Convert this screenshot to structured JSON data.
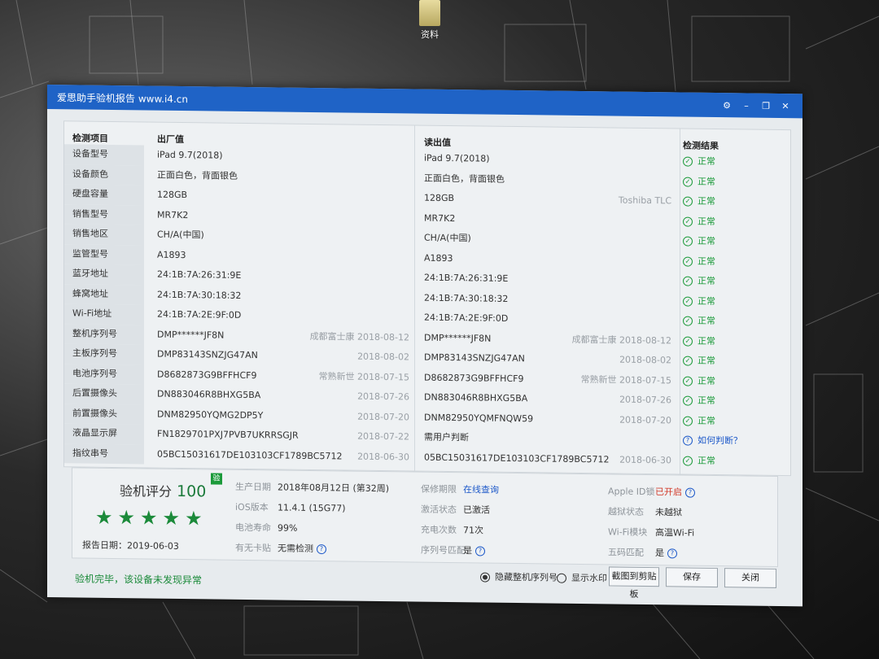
{
  "desktop": {
    "folder_label": "资料"
  },
  "window": {
    "title": "爱思助手验机报告 www.i4.cn"
  },
  "table": {
    "headers": {
      "item": "检测项目",
      "factory": "出厂值",
      "read": "读出值",
      "result": "检测结果"
    },
    "rows": [
      {
        "label": "设备型号",
        "factory": "iPad 9.7(2018)",
        "factory_extra": "",
        "read": "iPad 9.7(2018)",
        "read_extra": "",
        "result": "正常"
      },
      {
        "label": "设备颜色",
        "factory": "正面白色，背面银色",
        "factory_extra": "",
        "read": "正面白色，背面银色",
        "read_extra": "",
        "result": "正常"
      },
      {
        "label": "硬盘容量",
        "factory": "128GB",
        "factory_extra": "",
        "read": "128GB",
        "read_extra": "Toshiba TLC",
        "result": "正常"
      },
      {
        "label": "销售型号",
        "factory": "MR7K2",
        "factory_extra": "",
        "read": "MR7K2",
        "read_extra": "",
        "result": "正常"
      },
      {
        "label": "销售地区",
        "factory": "CH/A(中国)",
        "factory_extra": "",
        "read": "CH/A(中国)",
        "read_extra": "",
        "result": "正常"
      },
      {
        "label": "监管型号",
        "factory": "A1893",
        "factory_extra": "",
        "read": "A1893",
        "read_extra": "",
        "result": "正常"
      },
      {
        "label": "蓝牙地址",
        "factory": "24:1B:7A:26:31:9E",
        "factory_extra": "",
        "read": "24:1B:7A:26:31:9E",
        "read_extra": "",
        "result": "正常"
      },
      {
        "label": "蜂窝地址",
        "factory": "24:1B:7A:30:18:32",
        "factory_extra": "",
        "read": "24:1B:7A:30:18:32",
        "read_extra": "",
        "result": "正常"
      },
      {
        "label": "Wi-Fi地址",
        "factory": "24:1B:7A:2E:9F:0D",
        "factory_extra": "",
        "read": "24:1B:7A:2E:9F:0D",
        "read_extra": "",
        "result": "正常"
      },
      {
        "label": "整机序列号",
        "factory": "DMP******JF8N",
        "factory_extra": "成都富士康 2018-08-12",
        "read": "DMP******JF8N",
        "read_extra": "成都富士康 2018-08-12",
        "result": "正常"
      },
      {
        "label": "主板序列号",
        "factory": "DMP83143SNZJG47AN",
        "factory_extra": "2018-08-02",
        "read": "DMP83143SNZJG47AN",
        "read_extra": "2018-08-02",
        "result": "正常"
      },
      {
        "label": "电池序列号",
        "factory": "D8682873G9BFFHCF9",
        "factory_extra": "常熟新世 2018-07-15",
        "read": "D8682873G9BFFHCF9",
        "read_extra": "常熟新世 2018-07-15",
        "result": "正常"
      },
      {
        "label": "后置摄像头",
        "factory": "DN883046R8BHXG5BA",
        "factory_extra": "2018-07-26",
        "read": "DN883046R8BHXG5BA",
        "read_extra": "2018-07-26",
        "result": "正常"
      },
      {
        "label": "前置摄像头",
        "factory": "DNM82950YQMG2DP5Y",
        "factory_extra": "2018-07-20",
        "read": "DNM82950YQMFNQW59",
        "read_extra": "2018-07-20",
        "result": "正常"
      },
      {
        "label": "液晶显示屏",
        "factory": "FN1829701PXJ7PVB7UKRRSGJR",
        "factory_extra": "2018-07-22",
        "read": "需用户判断",
        "read_extra": "",
        "result": "如何判断？",
        "result_kind": "help"
      },
      {
        "label": "指纹串号",
        "factory": "05BC15031617DE103103CF1789BC5712",
        "factory_extra": "2018-06-30",
        "read": "05BC15031617DE103103CF1789BC5712",
        "read_extra": "2018-06-30",
        "result": "正常"
      }
    ]
  },
  "summary": {
    "score_label": "验机评分",
    "score": "100",
    "badge": "验",
    "stars": "★★★★★",
    "report_date": "报告日期：2019-06-03",
    "info": [
      {
        "key": "生产日期",
        "value": "2018年08月12日 (第32周)"
      },
      {
        "key": "iOS版本",
        "value": "11.4.1 (15G77)"
      },
      {
        "key": "电池寿命",
        "value": "99%"
      },
      {
        "key": "有无卡贴",
        "value": "无需检测"
      },
      {
        "key": "保修期限",
        "value": "在线查询"
      },
      {
        "key": "激活状态",
        "value": "已激活"
      },
      {
        "key": "充电次数",
        "value": "71次"
      },
      {
        "key": "序列号匹配",
        "value": "是"
      },
      {
        "key": "Apple ID锁",
        "value": "已开启"
      },
      {
        "key": "越狱状态",
        "value": "未越狱"
      },
      {
        "key": "Wi-Fi模块",
        "value": "高温Wi-Fi"
      },
      {
        "key": "五码匹配",
        "value": "是"
      }
    ]
  },
  "footer": {
    "status": "验机完毕，该设备未发现异常",
    "hide_serial": "隐藏整机序列号",
    "show_watermark": "显示水印",
    "screenshot_btn": "截图到剪贴板",
    "save_btn": "保存",
    "close_btn": "关闭"
  },
  "colors": {
    "titlebar": "#1f63c6",
    "ok_green": "#1b9a3a",
    "link_blue": "#1d59c9",
    "warn_red": "#d23a2a"
  }
}
